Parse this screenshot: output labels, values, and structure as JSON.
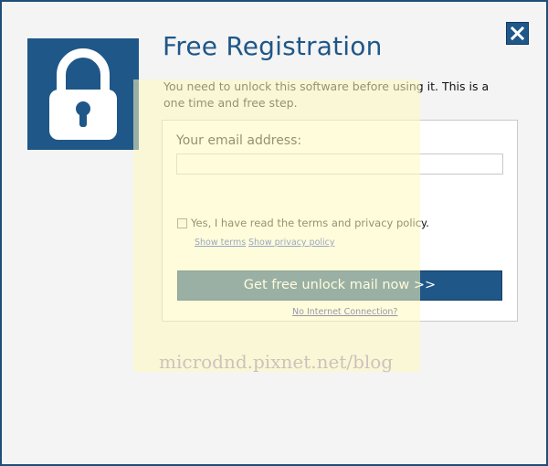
{
  "dialog": {
    "title": "Free Registration",
    "description": "You need to unlock this software before using it. This is a one time and free step.",
    "close_icon": "close-icon",
    "lock_icon": "padlock-icon"
  },
  "form": {
    "email_label": "Your email address:",
    "email_value": "",
    "terms_checked": false,
    "terms_label": "Yes, I have read the terms and privacy policy.",
    "show_terms_link": "Show terms",
    "show_privacy_link": "Show privacy policy",
    "submit_label": "Get free unlock mail now >>",
    "no_connection_link": "No Internet Connection?"
  },
  "watermark": {
    "text": "microdnd.pixnet.net/blog"
  },
  "colors": {
    "brand_blue": "#1f5788",
    "link_blue": "#1a3ec7",
    "window_border": "#1f4e79"
  }
}
